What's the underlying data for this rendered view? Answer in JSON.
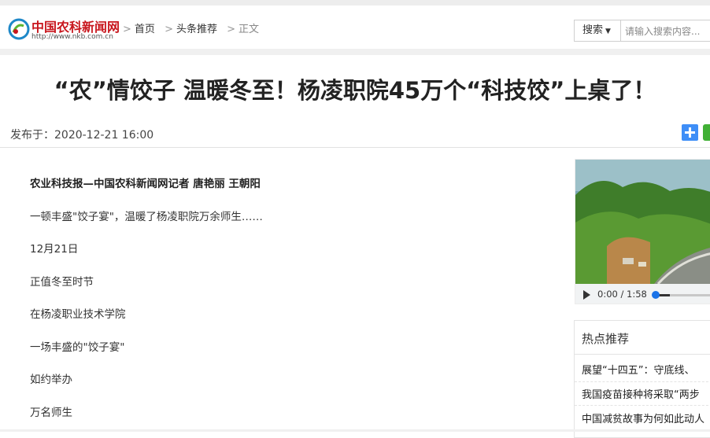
{
  "header": {
    "logo_text": "中国农科新闻网",
    "logo_url": "http://www.nkb.com.cn",
    "breadcrumb": [
      {
        "sep": ">",
        "label": "首页"
      },
      {
        "sep": ">",
        "label": "头条推荐"
      },
      {
        "sep": ">",
        "label": "正文"
      }
    ],
    "search": {
      "selected_option": "搜索",
      "placeholder": "请输入搜索内容..."
    }
  },
  "article": {
    "title": "“农”情饺子 温暖冬至！杨凌职院45万个“科技饺”上桌了！",
    "published": "发布于：2020-12-21 16:00",
    "paragraphs": [
      "农业科技报—中国农科新闻网记者 唐艳丽 王朝阳",
      "一顿丰盛\"饺子宴\"，温暖了杨凌职院万余师生……",
      "12月21日",
      "正值冬至时节",
      "在杨凌职业技术学院",
      "一场丰盛的\"饺子宴\"",
      "如约举办",
      "万名师生"
    ]
  },
  "video": {
    "time": "0:00 / 1:58",
    "progress": 0.0
  },
  "hot": {
    "title": "热点推荐",
    "items": [
      "展望“十四五”：守底线、",
      "我国疫苗接种将采取“两步",
      "中国减贫故事为何如此动人"
    ]
  },
  "colors": {
    "brand_red": "#c8161d",
    "share_blue": "#3e8ef7",
    "share_green": "#41b035",
    "video_knob": "#1a73e8"
  },
  "icons": [
    "logo-mark-icon",
    "chevron-down-icon",
    "plus-share-icon",
    "wechat-share-icon",
    "play-icon"
  ]
}
